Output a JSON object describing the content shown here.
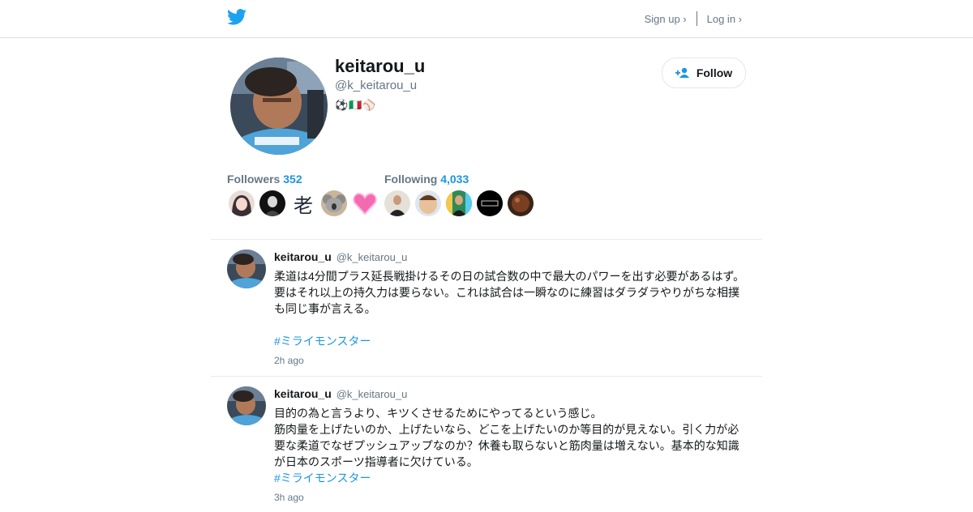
{
  "header": {
    "sign_up": "Sign up ›",
    "log_in": "Log in ›",
    "brand_color": "#1da1f2"
  },
  "profile": {
    "name": "keitarou_u",
    "handle": "@k_keitarou_u",
    "bio_emojis": "⚽🇮🇹⚾",
    "follow_label": "Follow",
    "followers_label": "Followers",
    "followers_count": "352",
    "following_label": "Following",
    "following_count": "4,033",
    "followers_preview": [
      {
        "icon": "anime-girl-avatar"
      },
      {
        "icon": "dark-figure-avatar"
      },
      {
        "icon": "kanji-avatar",
        "text": "老"
      },
      {
        "icon": "koala-avatar"
      },
      {
        "icon": "pink-heart-avatar"
      }
    ],
    "following_preview": [
      {
        "icon": "man-suit-avatar"
      },
      {
        "icon": "smiling-face-avatar"
      },
      {
        "icon": "man-stripes-avatar"
      },
      {
        "icon": "dark-logo-avatar"
      },
      {
        "icon": "brown-ball-avatar"
      }
    ]
  },
  "tweets": [
    {
      "name": "keitarou_u",
      "handle": "@k_keitarou_u",
      "text": "柔道は4分間プラス延長戦掛けるその日の試合数の中で最大のパワーを出す必要があるはず。\n要はそれ以上の持久力は要らない。これは試合は一瞬なのに練習はダラダラやりがちな相撲も同じ事が言える。",
      "hashtag": "#ミライモンスター",
      "time": "2h ago"
    },
    {
      "name": "keitarou_u",
      "handle": "@k_keitarou_u",
      "text": "目的の為と言うより、キツくさせるためにやってるという感じ。\n筋肉量を上げたいのか、上げたいなら、どこを上げたいのか等目的が見えない。引く力が必要な柔道でなぜプッシュアップなのか？休養も取らないと筋肉量は増えない。基本的な知識が日本のスポーツ指導者に欠けている。",
      "hashtag": "#ミライモンスター",
      "time": "3h ago"
    }
  ]
}
